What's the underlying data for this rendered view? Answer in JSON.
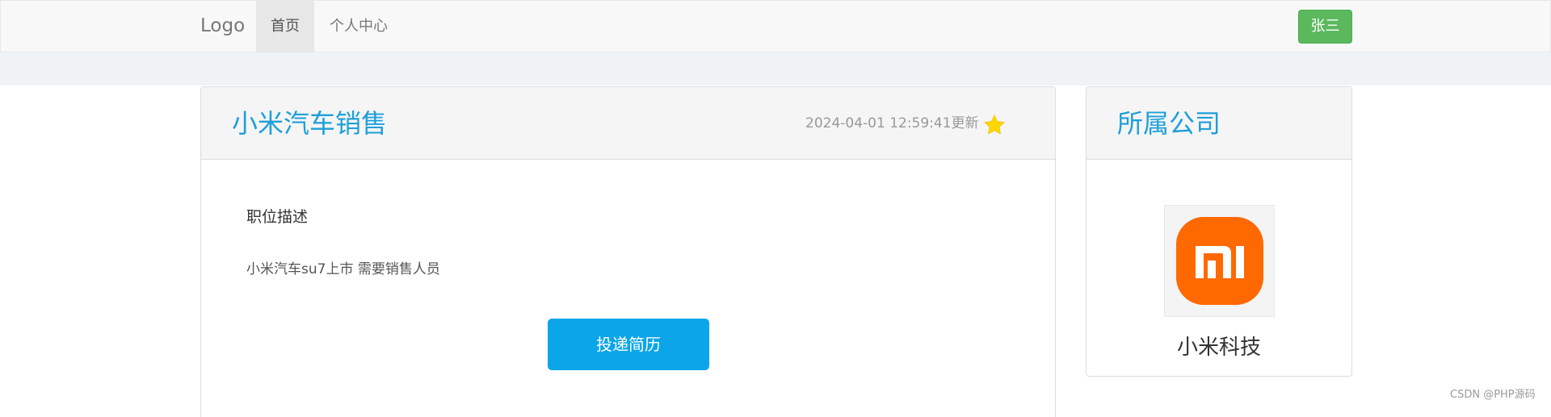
{
  "navbar": {
    "brand": "Logo",
    "items": [
      {
        "label": "首页",
        "active": true
      },
      {
        "label": "个人中心",
        "active": false
      }
    ],
    "user_button": "张三",
    "user_button_color": "#5cb85c"
  },
  "job": {
    "title": "小米汽车销售",
    "updated": "2024-04-01 12:59:41更新",
    "favorite_icon": "star-icon",
    "favorite_color": "#ffd700",
    "description_heading": "职位描述",
    "description": "小米汽车su7上市 需要销售人员",
    "apply_label": "投递简历",
    "apply_color": "#0ba5ea",
    "title_color": "#1e9fd9"
  },
  "company": {
    "heading": "所属公司",
    "name": "小米科技",
    "logo": "xiaomi-logo",
    "logo_color": "#ff6900"
  },
  "watermark": "CSDN @PHP源码"
}
